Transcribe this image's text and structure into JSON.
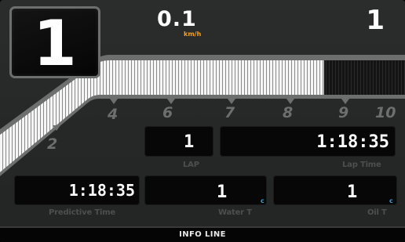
{
  "gear": {
    "value": "1"
  },
  "speed": {
    "value": "0.1",
    "unit": "km/h"
  },
  "position": {
    "value": "1"
  },
  "rpm": {
    "scale_labels": [
      "2",
      "4",
      "6",
      "7",
      "8",
      "9",
      "10"
    ],
    "fill_fraction": 0.8
  },
  "lap": {
    "value": "1",
    "label": "LAP"
  },
  "lap_time": {
    "value": "1:18:35",
    "label": "Lap Time"
  },
  "predictive_time": {
    "value": "1:18:35",
    "label": "Predictive Time"
  },
  "water_temp": {
    "value": "1",
    "unit": "c",
    "label": "Water T"
  },
  "oil_temp": {
    "value": "1",
    "unit": "c",
    "label": "Oil T"
  },
  "info_line": {
    "text": "INFO LINE"
  },
  "colors": {
    "background": "#282a2a",
    "accent_speed_unit": "#f3a021",
    "temp_unit": "#2fa3e6",
    "label_grey": "#4d4f4f"
  }
}
